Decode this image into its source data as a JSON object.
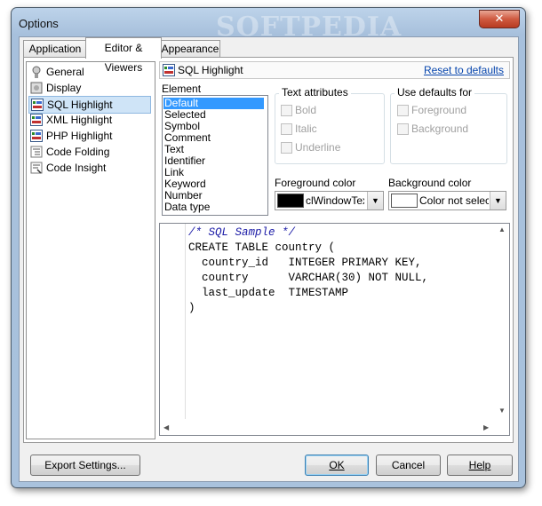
{
  "window": {
    "title": "Options",
    "watermark": "SOFTPEDIA",
    "close_label": "✕"
  },
  "tabs": [
    {
      "label": "Application"
    },
    {
      "label": "Editor & Viewers"
    },
    {
      "label": "Appearance"
    }
  ],
  "sidebar": {
    "items": [
      {
        "label": "General",
        "icon": "general-icon"
      },
      {
        "label": "Display",
        "icon": "display-icon"
      },
      {
        "label": "SQL Highlight",
        "icon": "sql-highlight-icon",
        "selected": true
      },
      {
        "label": "XML Highlight",
        "icon": "xml-highlight-icon"
      },
      {
        "label": "PHP Highlight",
        "icon": "php-highlight-icon"
      },
      {
        "label": "Code Folding",
        "icon": "code-folding-icon"
      },
      {
        "label": "Code Insight",
        "icon": "code-insight-icon"
      }
    ]
  },
  "header": {
    "title": "SQL Highlight",
    "reset_link": "Reset to defaults"
  },
  "element": {
    "label": "Element",
    "items": [
      "Default",
      "Selected",
      "Symbol",
      "Comment",
      "Text",
      "Identifier",
      "Link",
      "Keyword",
      "Number",
      "Data type"
    ],
    "selected": "Default"
  },
  "text_attributes": {
    "title": "Text attributes",
    "bold": "Bold",
    "italic": "Italic",
    "underline": "Underline"
  },
  "use_defaults": {
    "title": "Use defaults for",
    "foreground": "Foreground",
    "background": "Background"
  },
  "foreground_color": {
    "label": "Foreground color",
    "value": "clWindowText",
    "swatch": "#000000"
  },
  "background_color": {
    "label": "Background color",
    "value": "Color not selected",
    "swatch": "#ffffff"
  },
  "sample_code": {
    "comment": "/* SQL Sample */",
    "lines": [
      "CREATE TABLE country (",
      "  country_id   INTEGER PRIMARY KEY,",
      "  country      VARCHAR(30) NOT NULL,",
      "  last_update  TIMESTAMP",
      ")"
    ]
  },
  "buttons": {
    "export": "Export Settings...",
    "ok": "OK",
    "cancel": "Cancel",
    "help": "Help"
  }
}
